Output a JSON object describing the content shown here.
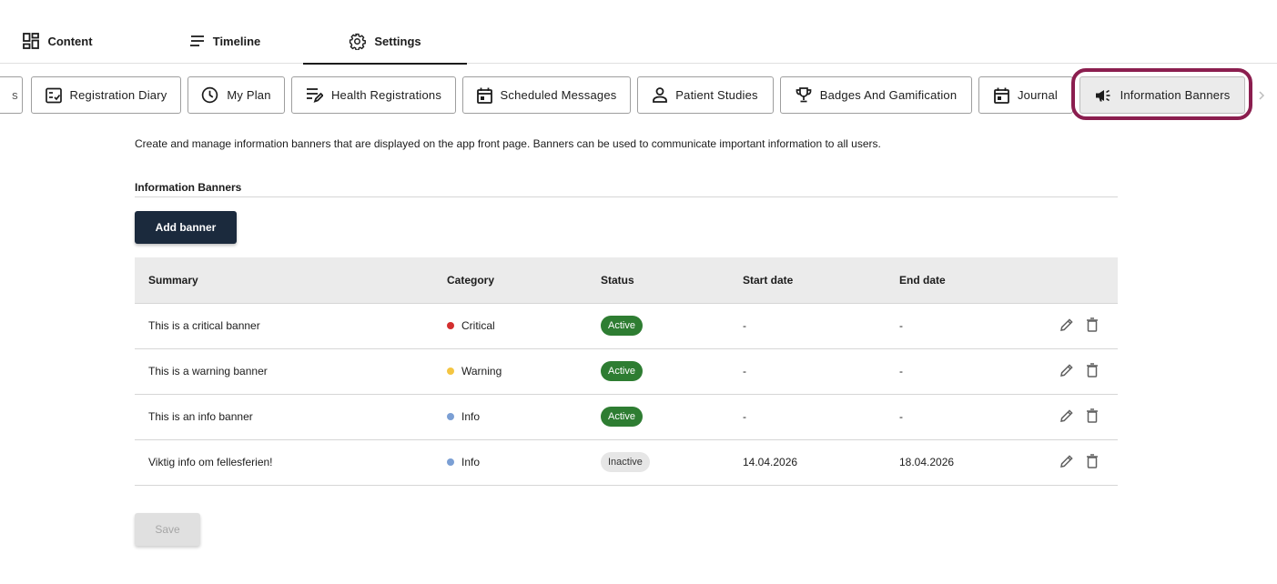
{
  "top_tabs": [
    {
      "label": "Content",
      "icon": "dashboard-icon"
    },
    {
      "label": "Timeline",
      "icon": "lines-icon"
    },
    {
      "label": "Settings",
      "icon": "gear-icon",
      "active": true
    }
  ],
  "sub_tabs": [
    {
      "label": "s",
      "icon": ""
    },
    {
      "label": "Registration Diary",
      "icon": "checklist-icon"
    },
    {
      "label": "My Plan",
      "icon": "clock-icon"
    },
    {
      "label": "Health Registrations",
      "icon": "edit-list-icon"
    },
    {
      "label": "Scheduled Messages",
      "icon": "calendar-icon"
    },
    {
      "label": "Patient Studies",
      "icon": "person-icon"
    },
    {
      "label": "Badges And Gamification",
      "icon": "trophy-icon"
    },
    {
      "label": "Journal",
      "icon": "calendar-icon"
    },
    {
      "label": "Information Banners",
      "icon": "megaphone-icon",
      "active": true
    }
  ],
  "description": "Create and manage information banners that are displayed on the app front page. Banners can be used to communicate important information to all users.",
  "section_title": "Information Banners",
  "add_button_label": "Add banner",
  "table": {
    "headers": {
      "summary": "Summary",
      "category": "Category",
      "status": "Status",
      "start": "Start date",
      "end": "End date"
    },
    "rows": [
      {
        "summary": "This is a critical banner",
        "category": "Critical",
        "category_color": "#d32f2f",
        "status": "Active",
        "start": "-",
        "end": "-"
      },
      {
        "summary": "This is a warning banner",
        "category": "Warning",
        "category_color": "#f4c542",
        "status": "Active",
        "start": "-",
        "end": "-"
      },
      {
        "summary": "This is an info banner",
        "category": "Info",
        "category_color": "#7b9fd4",
        "status": "Active",
        "start": "-",
        "end": "-"
      },
      {
        "summary": "Viktig info om fellesferien!",
        "category": "Info",
        "category_color": "#7b9fd4",
        "status": "Inactive",
        "start": "14.04.2026",
        "end": "18.04.2026"
      }
    ]
  },
  "save_button_label": "Save",
  "colors": {
    "primary_button": "#1b2a3d",
    "active_badge": "#2e7d32",
    "highlight_ring": "#8b1e4f"
  }
}
